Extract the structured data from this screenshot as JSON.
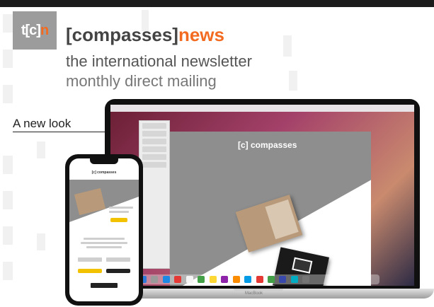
{
  "logo": {
    "prefix": "t[c]",
    "suffix": "n"
  },
  "title": {
    "main": "[compasses]",
    "accent": "news"
  },
  "subtitle1": "the international newsletter",
  "subtitle2": "monthly direct mailing",
  "new_look": "A new look",
  "laptop": {
    "app_logo": "[c] compasses",
    "base_label": "MacBook"
  },
  "phone": {
    "app_logo": "[c] compasses"
  },
  "colors": {
    "accent": "#f26b21",
    "logo_bg": "#9c9c9c",
    "text": "#555555"
  }
}
